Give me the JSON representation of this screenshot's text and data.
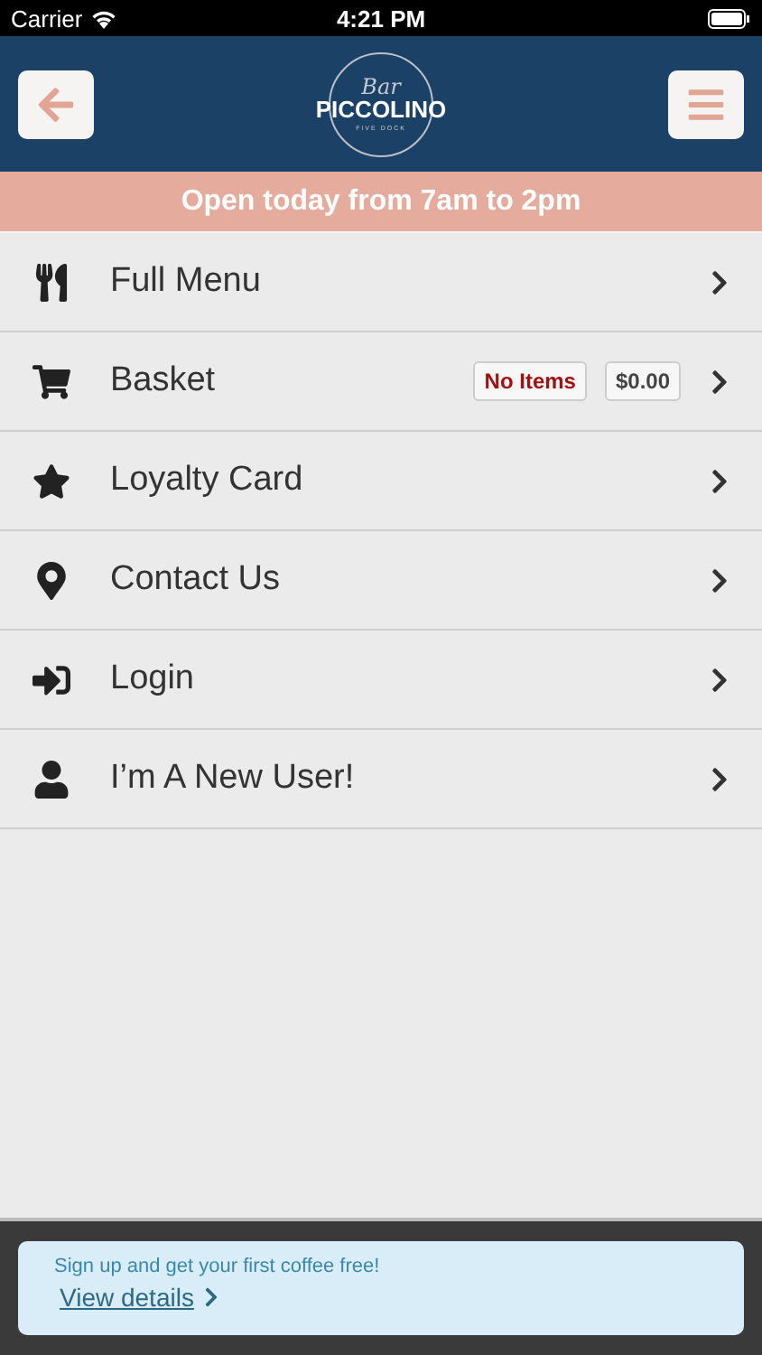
{
  "status_bar": {
    "carrier": "Carrier",
    "time": "4:21 PM"
  },
  "header": {
    "logo": {
      "script": "Bar",
      "name": "PICCOLINO",
      "tagline": "FIVE DOCK"
    }
  },
  "notice": "Open today from 7am to 2pm",
  "menu": [
    {
      "kind": "utensils",
      "label": "Full Menu"
    },
    {
      "kind": "cart",
      "label": "Basket",
      "badges": [
        {
          "kind": "alert",
          "text": "No Items"
        },
        {
          "kind": "plain",
          "text": "$0.00"
        }
      ]
    },
    {
      "kind": "star",
      "label": "Loyalty Card"
    },
    {
      "kind": "pin",
      "label": "Contact Us"
    },
    {
      "kind": "signin",
      "label": "Login"
    },
    {
      "kind": "user",
      "label": "I’m A New User!"
    }
  ],
  "promo": {
    "text": "Sign up and get your first coffee free!",
    "link": "View details"
  }
}
